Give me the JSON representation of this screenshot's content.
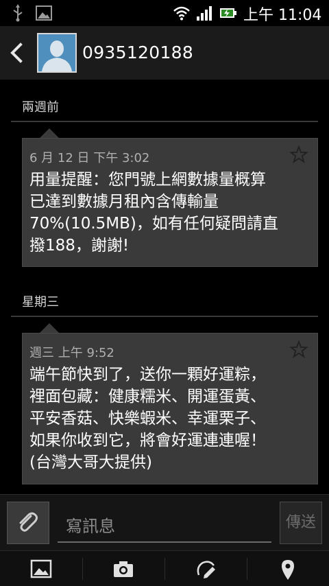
{
  "status_bar": {
    "time": "上午 11:04",
    "icons": [
      "usb-icon",
      "gallery-notification-icon",
      "wifi-icon",
      "cellular-signal-icon",
      "battery-charging-icon"
    ]
  },
  "header": {
    "contact_number": "0935120188",
    "icons": [
      "back-chevron-icon",
      "contact-avatar-icon"
    ]
  },
  "conversation": {
    "groups": [
      {
        "date_label": "兩週前",
        "message": {
          "timestamp": "6 月 12 日 下午 3:02",
          "lines": [
            "用量提醒：您門號上網數據量概算",
            "已達到數據月租內含傳輸量",
            "70%(10.5MB)，如有任何疑問請直",
            "撥188，謝謝!"
          ],
          "starred": false
        }
      },
      {
        "date_label": "星期三",
        "message": {
          "timestamp": "週三 上午 9:52",
          "lines": [
            "端午節快到了，送你一顆好運粽，",
            "裡面包藏：健康糯米、開運蛋黃、",
            "平安香菇、快樂蝦米、幸運栗子、",
            "如果你收到它，將會好運連連喔！",
            "(台灣大哥大提供)"
          ],
          "starred": false
        }
      }
    ]
  },
  "compose": {
    "placeholder": "寫訊息",
    "send_label": "傳送",
    "attach_icon": "paperclip-icon"
  },
  "toolbar": {
    "items": [
      "image-icon",
      "camera-icon",
      "draw-icon",
      "location-pin-icon"
    ]
  },
  "colors": {
    "background": "#000000",
    "header": "#1b1b1b",
    "bubble": "#3a3a3a",
    "timestamp_text": "#b0b0b0",
    "avatar": "#4f8fbd"
  }
}
